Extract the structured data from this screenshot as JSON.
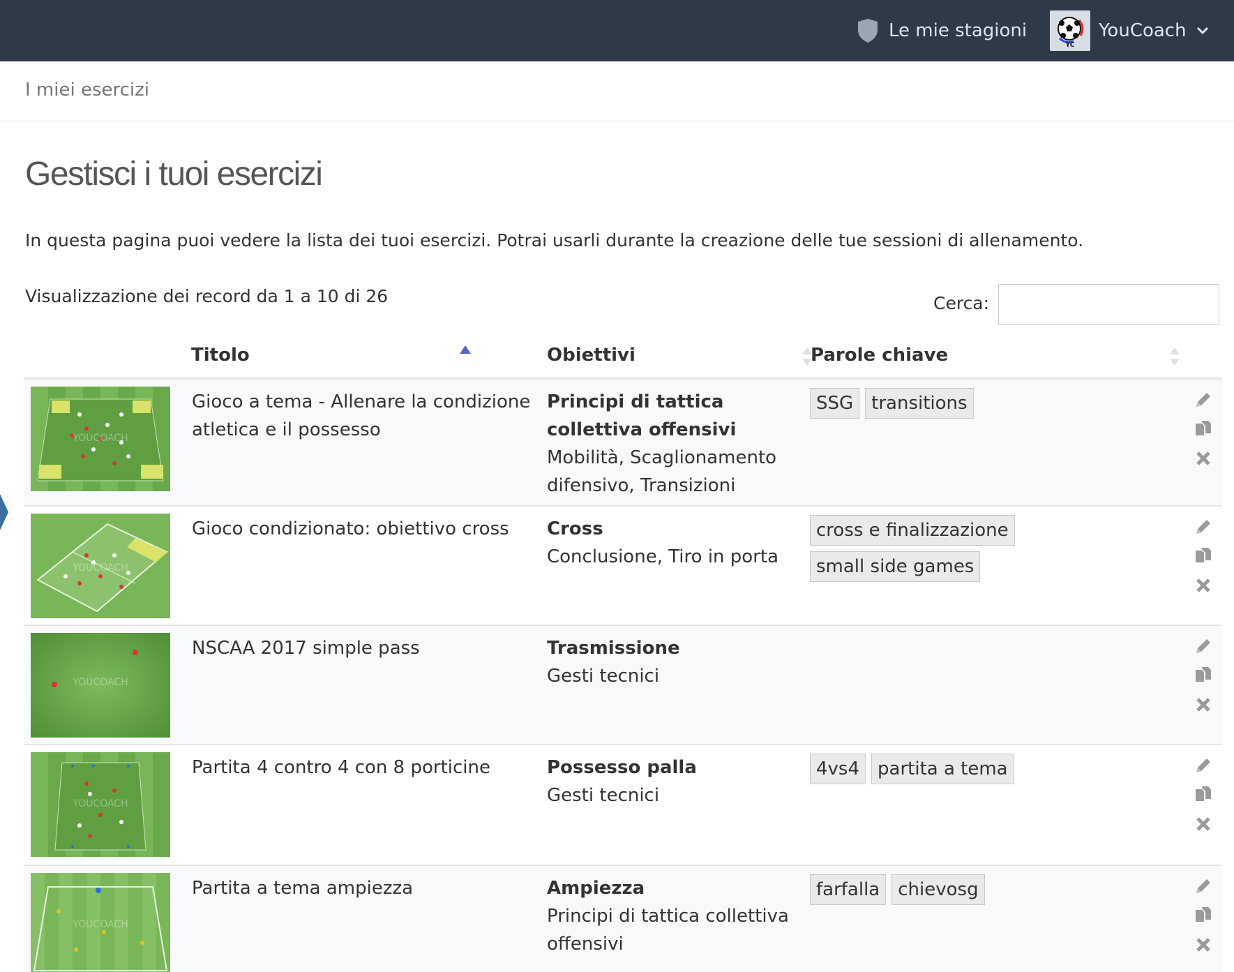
{
  "topbar": {
    "seasons_label": "Le mie stagioni",
    "user_label": "YouCoach",
    "avatar_text": "YC",
    "background": "#2e3a48"
  },
  "breadcrumb": {
    "label": "I miei esercizi"
  },
  "page": {
    "title": "Gestisci i tuoi esercizi",
    "intro": "In questa pagina puoi vedere la lista dei tuoi esercizi. Potrai usarli durante la creazione delle tue sessioni di allenamento.",
    "info": "Visualizzazione dei record da 1 a 10 di 26",
    "search_label": "Cerca:",
    "search_value": ""
  },
  "table": {
    "headers": [
      "Titolo",
      "Obiettivi",
      "Parole chiave"
    ],
    "sort_column": "Titolo",
    "sort_direction": "ascending",
    "rows": [
      {
        "title": "Gioco a tema - Allenare la condizione atletica e il possesso",
        "objective_main": "Principi di tattica collettiva offensivi",
        "objective_sub": "Mobilità, Scaglionamento difensivo, Transizioni",
        "keywords": [
          "SSG",
          "transitions"
        ],
        "thumbnail_watermark": "YOUCOACH"
      },
      {
        "title": "Gioco condizionato: obiettivo cross",
        "objective_main": "Cross",
        "objective_sub": "Conclusione, Tiro in porta",
        "keywords": [
          "cross e finalizzazione",
          "small side games"
        ],
        "thumbnail_watermark": "YOUCOACH"
      },
      {
        "title": "NSCAA 2017 simple pass",
        "objective_main": "Trasmissione",
        "objective_sub": "Gesti tecnici",
        "keywords": [],
        "thumbnail_watermark": "YOUCOACH"
      },
      {
        "title": "Partita 4 contro 4 con 8 porticine",
        "objective_main": "Possesso palla",
        "objective_sub": "Gesti tecnici",
        "keywords": [
          "4vs4",
          "partita a tema"
        ],
        "thumbnail_watermark": "YOUCOACH"
      },
      {
        "title": "Partita a tema ampiezza",
        "objective_main": "Ampiezza",
        "objective_sub": "Principi di tattica collettiva offensivi",
        "keywords": [
          "farfalla",
          "chievosg"
        ],
        "thumbnail_watermark": "YOUCOACH"
      }
    ],
    "row_actions": [
      "pencil-icon",
      "copy-icon",
      "close-icon"
    ]
  },
  "colors": {
    "pitch": "#6fad4e",
    "pitch_light": "#8cc26d",
    "tag_bg": "#eaeaea",
    "sort_active": "#5566c9"
  }
}
